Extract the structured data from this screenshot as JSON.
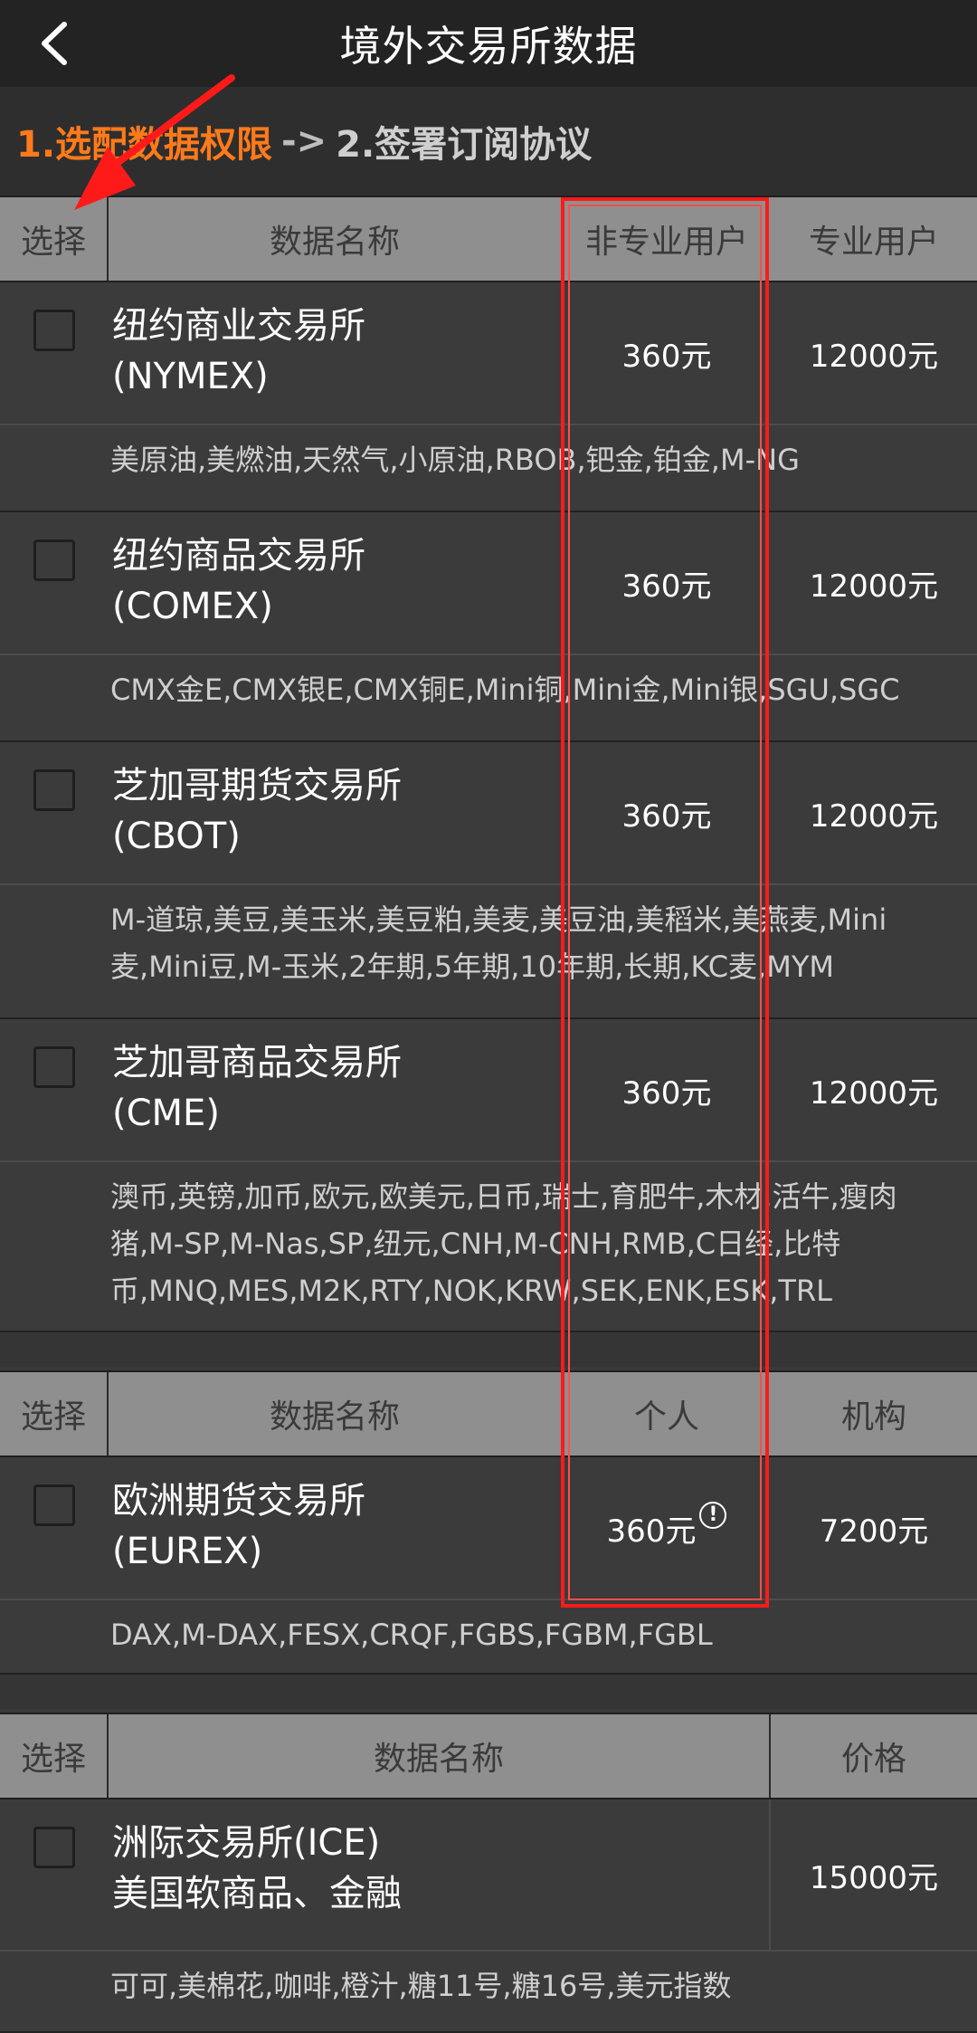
{
  "header": {
    "title": "境外交易所数据",
    "back_icon": "chevron-left-icon"
  },
  "steps": {
    "step1": "1.选配数据权限",
    "arrow": "->",
    "step2": "2.签署订阅协议"
  },
  "table1": {
    "headers": {
      "select": "选择",
      "name": "数据名称",
      "non_pro": "非专业用户",
      "pro": "专业用户"
    },
    "rows": [
      {
        "name_line1": "纽约商业交易所",
        "name_line2": "(NYMEX)",
        "non_pro": "360元",
        "pro": "12000元",
        "desc": "美原油,美燃油,天然气,小原油,RBOB,钯金,铂金,M-NG"
      },
      {
        "name_line1": "纽约商品交易所",
        "name_line2": "(COMEX)",
        "non_pro": "360元",
        "pro": "12000元",
        "desc": "CMX金E,CMX银E,CMX铜E,Mini铜,Mini金,Mini银,SGU,SGC"
      },
      {
        "name_line1": "芝加哥期货交易所",
        "name_line2": "(CBOT)",
        "non_pro": "360元",
        "pro": "12000元",
        "desc": "M-道琼,美豆,美玉米,美豆粕,美麦,美豆油,美稻米,美燕麦,Mini麦,Mini豆,M-玉米,2年期,5年期,10年期,长期,KC麦,MYM"
      },
      {
        "name_line1": "芝加哥商品交易所",
        "name_line2": "(CME)",
        "non_pro": "360元",
        "pro": "12000元",
        "desc": "澳币,英镑,加币,欧元,欧美元,日币,瑞士,育肥牛,木材,活牛,瘦肉猪,M-SP,M-Nas,SP,纽元,CNH,M-CNH,RMB,C日经,比特币,MNQ,MES,M2K,RTY,NOK,KRW,SEK,ENK,ESK,TRL"
      }
    ]
  },
  "table2": {
    "headers": {
      "select": "选择",
      "name": "数据名称",
      "personal": "个人",
      "institution": "机构"
    },
    "rows": [
      {
        "name_line1": "欧洲期货交易所",
        "name_line2": "(EUREX)",
        "personal": "360元",
        "institution": "7200元",
        "info_icon": "info-circle-icon",
        "info_mark": "!",
        "desc": "DAX,M-DAX,FESX,CRQF,FGBS,FGBM,FGBL"
      }
    ]
  },
  "table3": {
    "headers": {
      "select": "选择",
      "name": "数据名称",
      "price": "价格"
    },
    "rows": [
      {
        "name_line1": "洲际交易所(ICE)",
        "name_line2": "美国软商品、金融",
        "price": "15000元",
        "desc": "可可,美棉花,咖啡,橙汁,糖11号,糖16号,美元指数"
      }
    ]
  },
  "annotation": {
    "arrow_color": "#ff1a1a",
    "highlight_color": "#ff1a1a"
  }
}
